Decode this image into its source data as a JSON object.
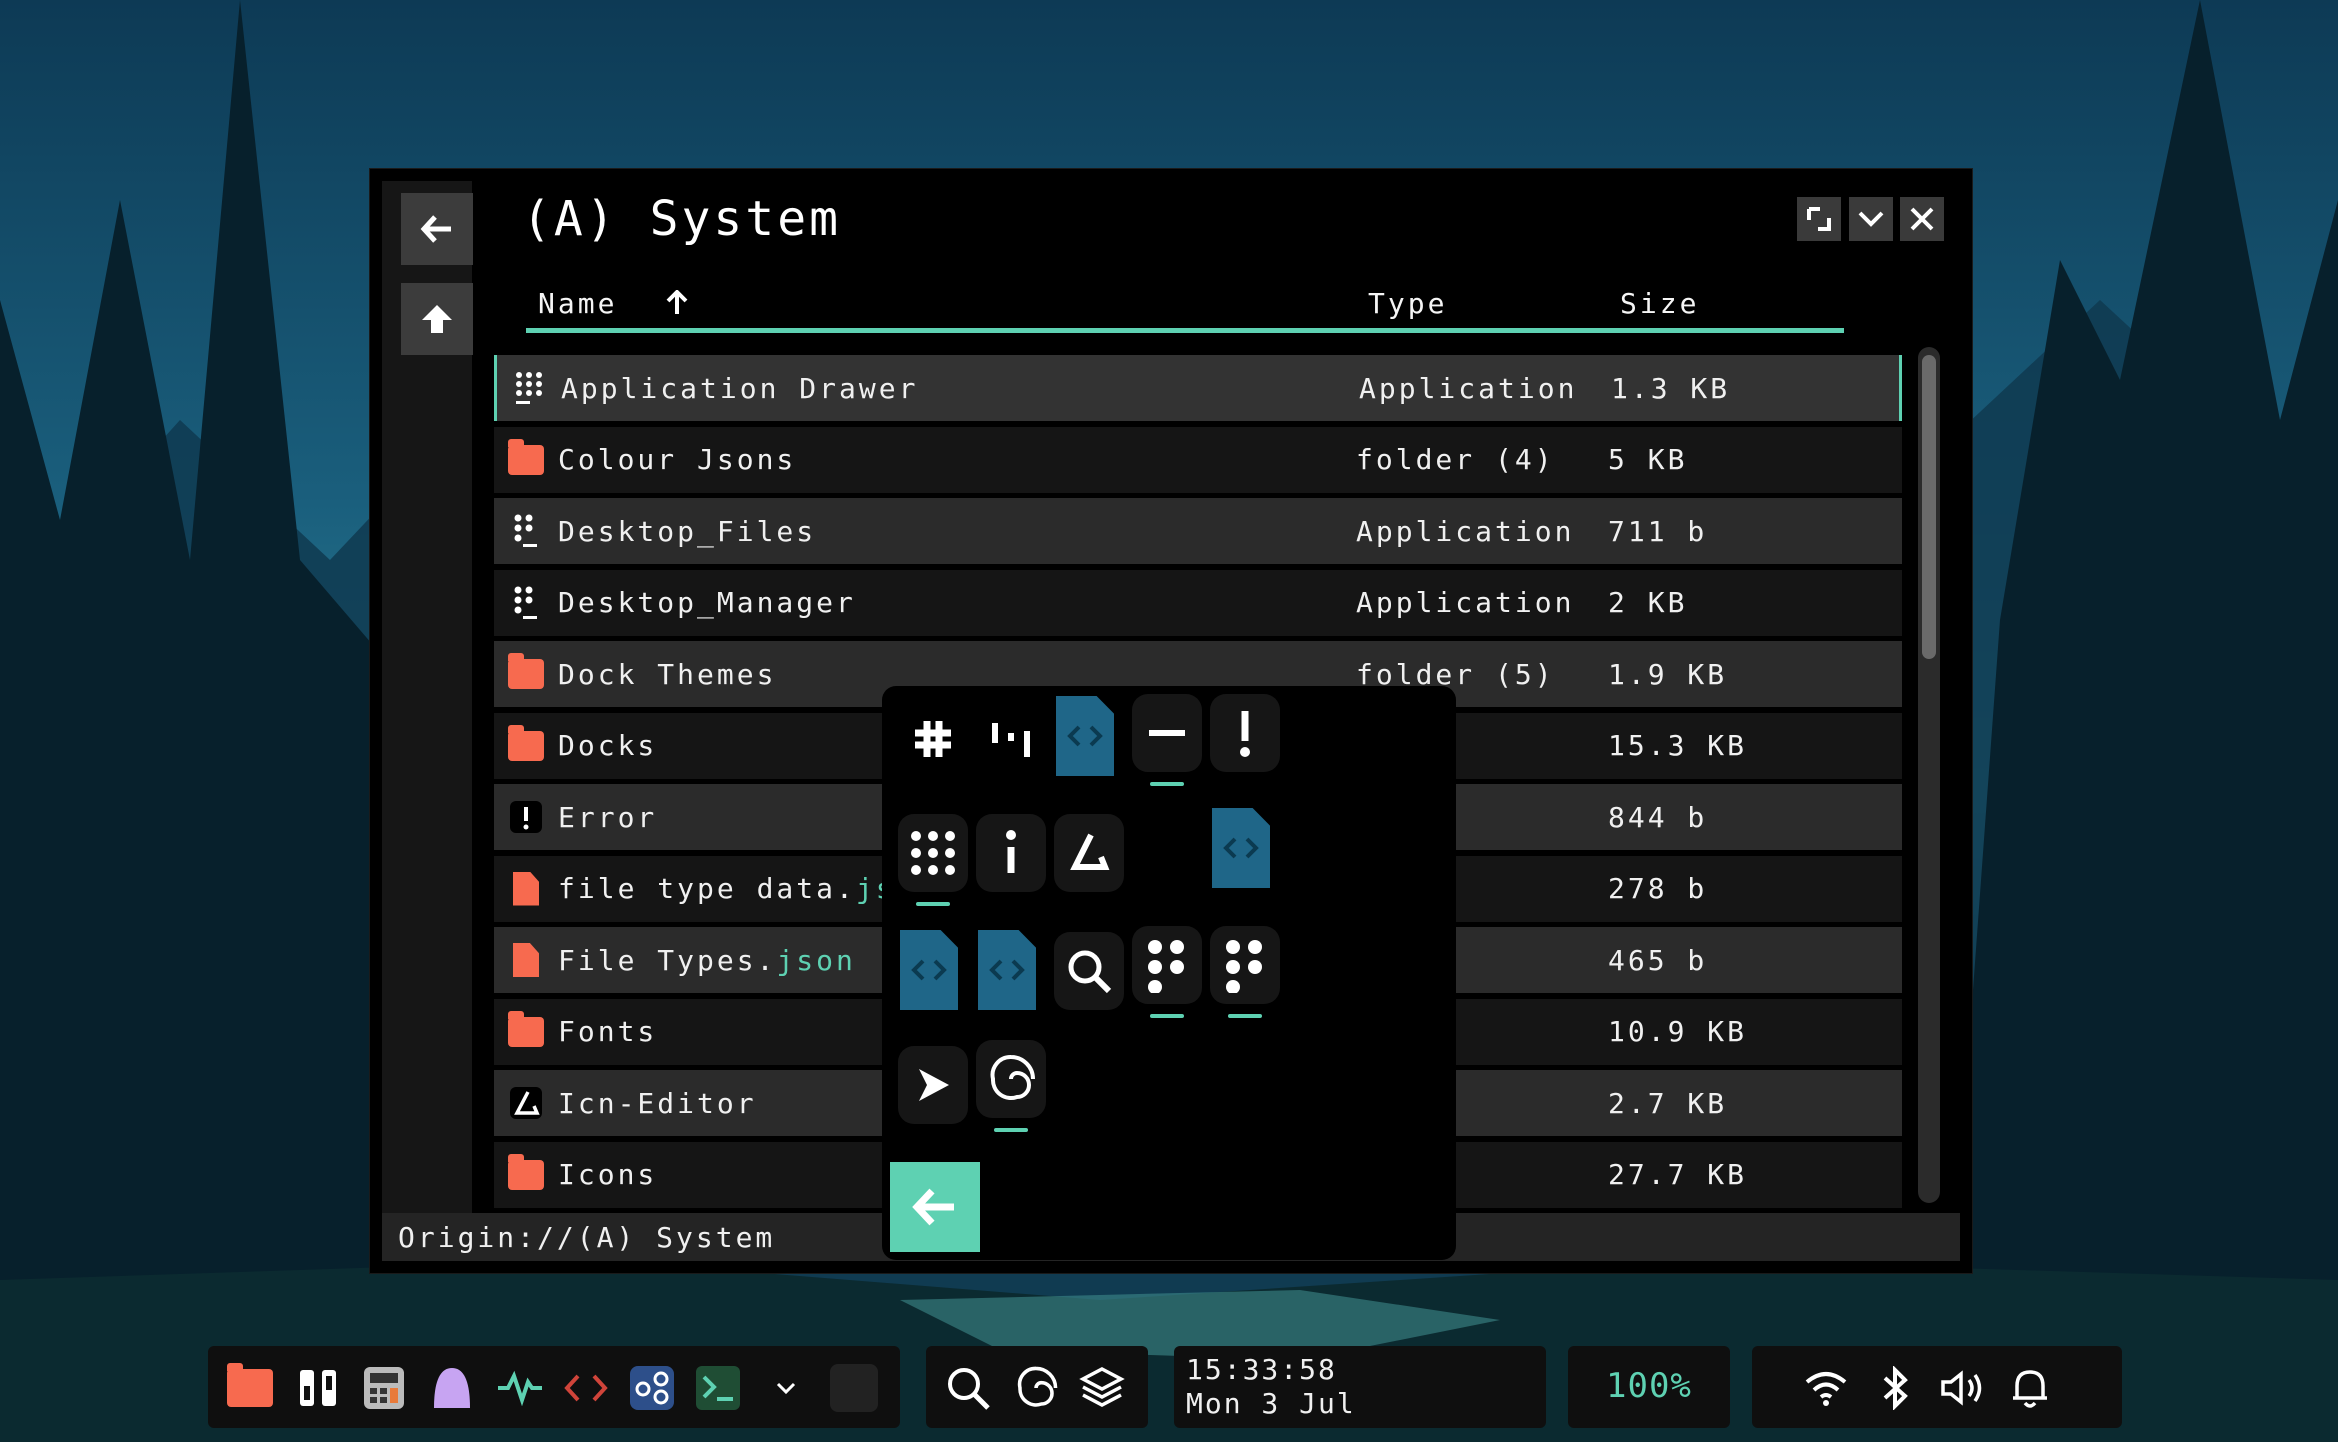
{
  "window": {
    "title": "(A) System",
    "columns": {
      "name": "Name",
      "type": "Type",
      "size": "Size"
    },
    "sort_indicator": "arrow-up-icon",
    "rows": [
      {
        "icon": "app-drawer-icon",
        "name": "Application Drawer",
        "name_ext": "",
        "type": "Application",
        "size": "1.3 KB"
      },
      {
        "icon": "folder-icon",
        "name": "Colour Jsons",
        "name_ext": "",
        "type": "folder (4)",
        "size": "5 KB"
      },
      {
        "icon": "app-icon",
        "name": "Desktop_Files",
        "name_ext": "",
        "type": "Application",
        "size": "711 b"
      },
      {
        "icon": "app-icon",
        "name": "Desktop_Manager",
        "name_ext": "",
        "type": "Application",
        "size": "2 KB"
      },
      {
        "icon": "folder-icon",
        "name": "Dock Themes",
        "name_ext": "",
        "type": "folder (5)",
        "size": "1.9 KB"
      },
      {
        "icon": "folder-icon",
        "name": "Docks",
        "name_ext": "",
        "type": "(23)",
        "size": "15.3 KB"
      },
      {
        "icon": "error-icon",
        "name": "Error",
        "name_ext": "",
        "type": "ation",
        "size": "844 b"
      },
      {
        "icon": "file-icon",
        "name": "file type data.",
        "name_ext": "json",
        "type": "",
        "size": "278 b"
      },
      {
        "icon": "file-icon",
        "name": "File Types.",
        "name_ext": "json",
        "type": "",
        "size": "465 b"
      },
      {
        "icon": "folder-icon",
        "name": "Fonts",
        "name_ext": "",
        "type": "(3)",
        "size": "10.9 KB"
      },
      {
        "icon": "icon-editor-icon",
        "name": "Icn-Editor",
        "name_ext": "",
        "type": "ation",
        "size": "2.7 KB"
      },
      {
        "icon": "folder-icon",
        "name": "Icons",
        "name_ext": "",
        "type": "(89)",
        "size": "27.7 KB"
      }
    ],
    "status_path": "Origin://(A) System"
  },
  "taskbar": {
    "time": "15:33:58",
    "date": "Mon 3 Jul",
    "battery": "100%"
  },
  "colors": {
    "accent": "#5ed1b2",
    "folder": "#f76a4f",
    "code_file": "#1f6688"
  }
}
